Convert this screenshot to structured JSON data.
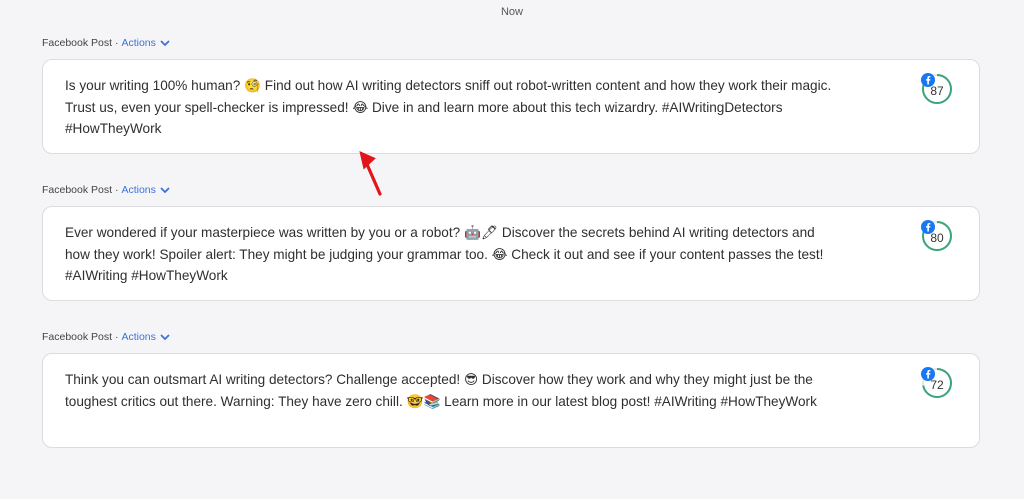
{
  "timestamp": "Now",
  "posts": [
    {
      "type_label": "Facebook Post ·",
      "actions_label": "Actions",
      "text": "Is your writing 100% human? 🧐 Find out how AI writing detectors sniff out robot-written content and how they work their magic. Trust us, even your spell-checker is impressed! 😂 Dive in and learn more about this tech wizardry. #AIWritingDetectors #HowTheyWork",
      "score": "87",
      "score_fraction": 0.87
    },
    {
      "type_label": "Facebook Post ·",
      "actions_label": "Actions",
      "text": "Ever wondered if your masterpiece was written by you or a robot? 🤖🖊 Discover the secrets behind AI writing detectors and how they work! Spoiler alert: They might be judging your grammar too. 😂 Check it out and see if your content passes the test! #AIWriting #HowTheyWork",
      "score": "80",
      "score_fraction": 0.8
    },
    {
      "type_label": "Facebook Post ·",
      "actions_label": "Actions",
      "text": "Think you can outsmart AI writing detectors? Challenge accepted! 😎 Discover how they work and why they might just be the toughest critics out there. Warning: They have zero chill. 🤓📚 Learn more in our latest blog post! #AIWriting #HowTheyWork",
      "score": "72",
      "score_fraction": 0.72
    }
  ],
  "colors": {
    "accent": "#3b73d9",
    "score_ring": "#3aa57a",
    "facebook": "#1877f2",
    "arrow": "#e0161b"
  },
  "icons": [
    "chevron-down-icon",
    "facebook-icon",
    "red-arrow-annotation"
  ]
}
